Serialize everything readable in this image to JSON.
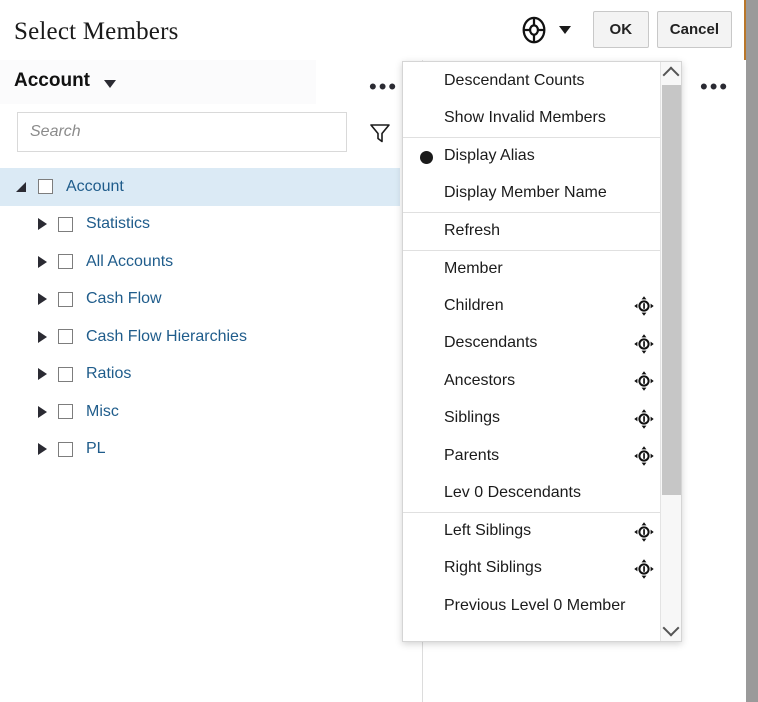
{
  "dialog": {
    "title": "Select Members",
    "header_icon": "wheel-icon",
    "header_caret": "caret-down-icon",
    "ok_label": "OK",
    "cancel_label": "Cancel"
  },
  "left_panel": {
    "dimension_name": "Account",
    "dimension_caret": "caret-down-icon",
    "overflow_label": "•••",
    "search": {
      "value": "",
      "placeholder": "Search"
    },
    "filter_icon": "filter-icon"
  },
  "right_panel": {
    "overflow_label": "•••"
  },
  "tree": {
    "items": [
      {
        "label": "Account",
        "level": 0,
        "expanded": true,
        "checked": false,
        "selected": true
      },
      {
        "label": "Statistics",
        "level": 1,
        "expanded": false,
        "checked": false,
        "selected": false
      },
      {
        "label": "All Accounts",
        "level": 1,
        "expanded": false,
        "checked": false,
        "selected": false
      },
      {
        "label": "Cash Flow",
        "level": 1,
        "expanded": false,
        "checked": false,
        "selected": false
      },
      {
        "label": "Cash Flow Hierarchies",
        "level": 1,
        "expanded": false,
        "checked": false,
        "selected": false
      },
      {
        "label": "Ratios",
        "level": 1,
        "expanded": false,
        "checked": false,
        "selected": false
      },
      {
        "label": "Misc",
        "level": 1,
        "expanded": false,
        "checked": false,
        "selected": false
      },
      {
        "label": "PL",
        "level": 1,
        "expanded": false,
        "checked": false,
        "selected": false
      }
    ]
  },
  "menu": {
    "items": [
      {
        "label": "Descendant Counts",
        "separator_above": false,
        "selected": false,
        "target_icon": false
      },
      {
        "label": "Show Invalid Members",
        "separator_above": false,
        "selected": false,
        "target_icon": false
      },
      {
        "label": "Display Alias",
        "separator_above": true,
        "selected": true,
        "target_icon": false
      },
      {
        "label": "Display Member Name",
        "separator_above": false,
        "selected": false,
        "target_icon": false
      },
      {
        "label": "Refresh",
        "separator_above": true,
        "selected": false,
        "target_icon": false
      },
      {
        "label": "Member",
        "separator_above": true,
        "selected": false,
        "target_icon": false
      },
      {
        "label": "Children",
        "separator_above": false,
        "selected": false,
        "target_icon": true
      },
      {
        "label": "Descendants",
        "separator_above": false,
        "selected": false,
        "target_icon": true
      },
      {
        "label": "Ancestors",
        "separator_above": false,
        "selected": false,
        "target_icon": true
      },
      {
        "label": "Siblings",
        "separator_above": false,
        "selected": false,
        "target_icon": true
      },
      {
        "label": "Parents",
        "separator_above": false,
        "selected": false,
        "target_icon": true
      },
      {
        "label": "Lev 0 Descendants",
        "separator_above": false,
        "selected": false,
        "target_icon": false
      },
      {
        "label": "Left Siblings",
        "separator_above": true,
        "selected": false,
        "target_icon": true
      },
      {
        "label": "Right Siblings",
        "separator_above": false,
        "selected": false,
        "target_icon": true
      },
      {
        "label": "Previous Level 0 Member",
        "separator_above": false,
        "selected": false,
        "target_icon": false
      }
    ],
    "scrollbar": {
      "up_icon": "chevron-up-icon",
      "down_icon": "chevron-down-icon"
    }
  },
  "colors": {
    "tree_link": "#1f5c8b",
    "tree_selected_bg": "#dbeaf5",
    "accent_strip": "#b8762a",
    "scrollbar_thumb": "#c6c6c6"
  }
}
